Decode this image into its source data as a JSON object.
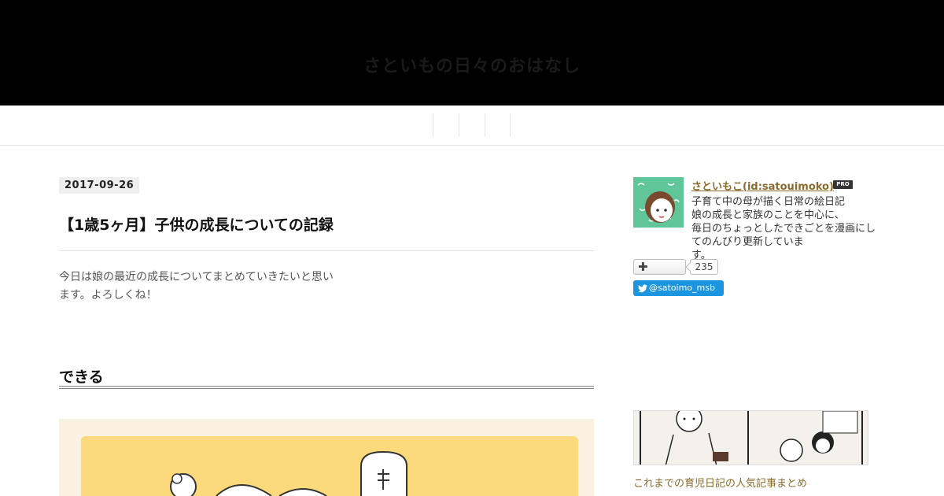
{
  "header": {
    "title": "さといもの日々のおはなし"
  },
  "nav": {
    "items": [
      "",
      "",
      ""
    ]
  },
  "entry": {
    "date": "2017-09-26",
    "title": "【1歳5ヶ月】子供の成長についての記録",
    "body_line1": "今日は娘の最近の成長についてまとめていきたいと思い",
    "body_line2": "ます。よろしくね！",
    "section_heading": "できる"
  },
  "sidebar": {
    "author_name": "さといもこ(id:satouimoko)",
    "pro_badge": "PRO",
    "desc_line1": "子育て中の母が描く日常の絵日記",
    "desc_line2": "娘の成長と家族のことを中心に、",
    "desc_line3": "毎日のちょっとしたできごとを漫画にしてのんびり更新していま",
    "desc_line4": "す。",
    "subscribe_count": "235",
    "twitter_handle": "@satoimo_msb",
    "related_caption": "これまでの育児日記の人気記事まとめ"
  },
  "colors": {
    "header_bg": "#000000",
    "link": "#8a6b2b",
    "twitter": "#1b95e0"
  }
}
